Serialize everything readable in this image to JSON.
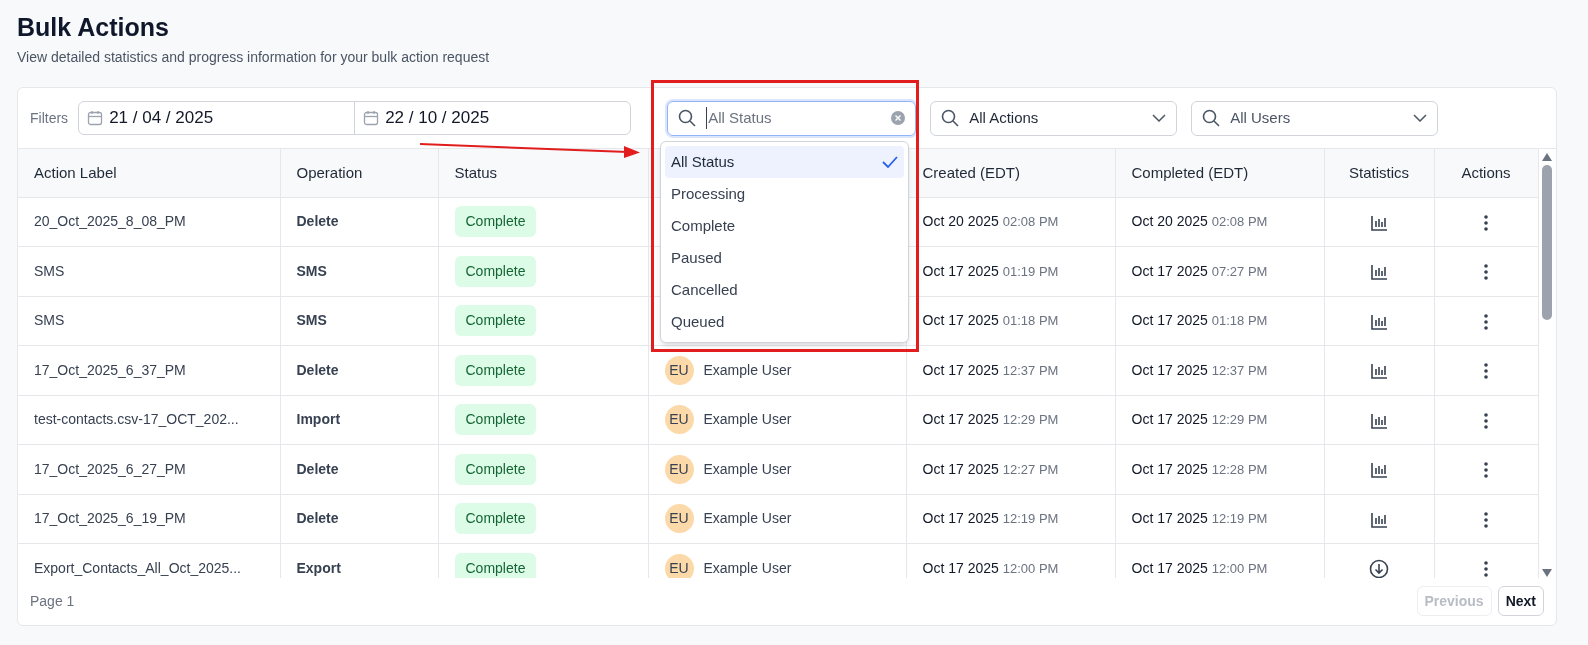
{
  "page": {
    "title": "Bulk Actions",
    "subtitle": "View detailed statistics and progress information for your bulk action request"
  },
  "filters": {
    "label": "Filters",
    "date_from": "21 / 04 / 2025",
    "date_to": "22 / 10 / 2025",
    "status": {
      "placeholder": "All Status",
      "expanded": true,
      "options": [
        {
          "label": "All Status",
          "selected": true
        },
        {
          "label": "Processing",
          "selected": false
        },
        {
          "label": "Complete",
          "selected": false
        },
        {
          "label": "Paused",
          "selected": false
        },
        {
          "label": "Cancelled",
          "selected": false
        },
        {
          "label": "Queued",
          "selected": false
        }
      ]
    },
    "actions": {
      "value": "All Actions"
    },
    "users": {
      "placeholder": "All Users"
    }
  },
  "table": {
    "columns": [
      "Action Label",
      "Operation",
      "Status",
      "Created (EDT)",
      "Completed (EDT)",
      "Statistics",
      "Actions"
    ],
    "rows": [
      {
        "label": "20_Oct_2025_8_08_PM",
        "operation": "Delete",
        "status": "Complete",
        "created_date": "Oct 20 2025",
        "created_time": "02:08 PM",
        "completed_date": "Oct 20 2025",
        "completed_time": "02:08 PM",
        "kind": "chart"
      },
      {
        "label": "SMS",
        "operation": "SMS",
        "status": "Complete",
        "created_date": "Oct 17 2025",
        "created_time": "01:19 PM",
        "completed_date": "Oct 17 2025",
        "completed_time": "07:27 PM",
        "kind": "chart"
      },
      {
        "label": "SMS",
        "operation": "SMS",
        "status": "Complete",
        "created_date": "Oct 17 2025",
        "created_time": "01:18 PM",
        "completed_date": "Oct 17 2025",
        "completed_time": "01:18 PM",
        "kind": "chart"
      },
      {
        "label": "17_Oct_2025_6_37_PM",
        "operation": "Delete",
        "status": "Complete",
        "user_initials": "EU",
        "user": "Example User",
        "created_date": "Oct 17 2025",
        "created_time": "12:37 PM",
        "completed_date": "Oct 17 2025",
        "completed_time": "12:37 PM",
        "kind": "chart"
      },
      {
        "label": "test-contacts.csv-17_OCT_202...",
        "operation": "Import",
        "status": "Complete",
        "user_initials": "EU",
        "user": "Example User",
        "created_date": "Oct 17 2025",
        "created_time": "12:29 PM",
        "completed_date": "Oct 17 2025",
        "completed_time": "12:29 PM",
        "kind": "chart"
      },
      {
        "label": "17_Oct_2025_6_27_PM",
        "operation": "Delete",
        "status": "Complete",
        "user_initials": "EU",
        "user": "Example User",
        "created_date": "Oct 17 2025",
        "created_time": "12:27 PM",
        "completed_date": "Oct 17 2025",
        "completed_time": "12:28 PM",
        "kind": "chart"
      },
      {
        "label": "17_Oct_2025_6_19_PM",
        "operation": "Delete",
        "status": "Complete",
        "user_initials": "EU",
        "user": "Example User",
        "created_date": "Oct 17 2025",
        "created_time": "12:19 PM",
        "completed_date": "Oct 17 2025",
        "completed_time": "12:19 PM",
        "kind": "chart"
      },
      {
        "label": "Export_Contacts_All_Oct_2025...",
        "operation": "Export",
        "status": "Complete",
        "user_initials": "EU",
        "user": "Example User",
        "created_date": "Oct 17 2025",
        "created_time": "12:00 PM",
        "completed_date": "Oct 17 2025",
        "completed_time": "12:00 PM",
        "kind": "download"
      }
    ]
  },
  "footer": {
    "page": "Page 1",
    "previous": {
      "label": "Previous",
      "disabled": true
    },
    "next": {
      "label": "Next",
      "disabled": false
    }
  }
}
